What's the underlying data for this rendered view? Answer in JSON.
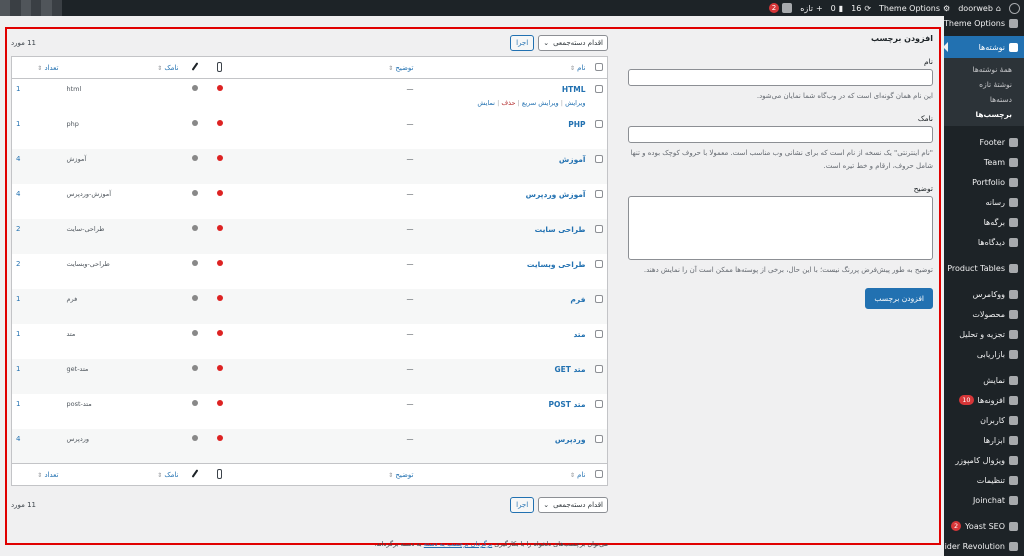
{
  "adminbar": {
    "site_name": "doorweb",
    "theme_options": "Theme Options",
    "updates_count": "16",
    "comments_count": "0",
    "new_label": "تازه",
    "yoast_badge": "2"
  },
  "sidebar": {
    "top_item": "Theme Options",
    "current": "نوشته‌ها",
    "submenu": [
      "همهٔ نوشته‌ها",
      "نوشتهٔ تازه",
      "دسته‌ها",
      "برچسب‌ها"
    ],
    "active_sub": "برچسب‌ها",
    "items": [
      {
        "label": "Footer",
        "icon": "copy-icon"
      },
      {
        "label": "Team",
        "icon": "team-icon"
      },
      {
        "label": "Portfolio",
        "icon": "portfolio-icon"
      },
      {
        "label": "رسانه",
        "icon": "media-icon"
      },
      {
        "label": "برگه‌ها",
        "icon": "pages-icon"
      },
      {
        "label": "دیدگاه‌ها",
        "icon": "comments-icon"
      },
      {
        "label": "Product Tables",
        "icon": "table-icon"
      },
      {
        "label": "ووکامرس",
        "icon": "woocommerce-icon"
      },
      {
        "label": "محصولات",
        "icon": "products-icon"
      },
      {
        "label": "تجزیه و تحلیل",
        "icon": "analytics-icon"
      },
      {
        "label": "بازاریابی",
        "icon": "megaphone-icon"
      },
      {
        "label": "نمایش",
        "icon": "appearance-icon"
      },
      {
        "label": "افزونه‌ها",
        "icon": "plugins-icon",
        "badge": "10"
      },
      {
        "label": "کاربران",
        "icon": "users-icon"
      },
      {
        "label": "ابزارها",
        "icon": "tools-icon"
      },
      {
        "label": "ویژوال کامپوزر",
        "icon": "composer-icon"
      },
      {
        "label": "تنظیمات",
        "icon": "settings-icon"
      },
      {
        "label": "Joinchat",
        "icon": "whatsapp-icon"
      },
      {
        "label": "Yoast SEO",
        "icon": "yoast-icon",
        "badge": "2"
      },
      {
        "label": "Slider Revolution",
        "icon": "refresh-icon"
      }
    ]
  },
  "form": {
    "title": "افزودن برچسب",
    "name_label": "نام",
    "name_help": "این نام همان گونه‌ای است که در وب‌گاه شما نمایان می‌شود.",
    "slug_label": "نامک",
    "slug_help": "\"نام اینترنتی\" یک نسخه از نام است که برای نشانی وب مناسب است. معمولا با حروف کوچک بوده و تنها شامل حروف، ارقام و خط تیره است.",
    "desc_label": "توضیح",
    "desc_help": "توضیح به طور پیش‌فرض پررنگ نیست؛ با این حال، برخی از پوسته‌ها ممکن است آن را نمایش دهند.",
    "submit": "افزودن برچسب"
  },
  "list": {
    "bulk_action": "اقدام دسته‌جمعی",
    "apply": "اجرا",
    "items_count": "11 مورد",
    "columns": {
      "name": "نام",
      "description": "توضیح",
      "slug": "نامک",
      "count": "تعداد"
    },
    "row_actions": [
      "ویرایش",
      "ویرایش سریع",
      "حذف",
      "نمایش"
    ],
    "rows": [
      {
        "name": "HTML",
        "description": "—",
        "slug": "html",
        "count": "1"
      },
      {
        "name": "PHP",
        "description": "—",
        "slug": "php",
        "count": "1"
      },
      {
        "name": "آموزش",
        "description": "—",
        "slug": "آموزش",
        "count": "4"
      },
      {
        "name": "آموزش وردپرس",
        "description": "—",
        "slug": "آموزش-وردپرس",
        "count": "4"
      },
      {
        "name": "طراحی سایت",
        "description": "—",
        "slug": "طراحی-سایت",
        "count": "2"
      },
      {
        "name": "طراحی وبسایت",
        "description": "—",
        "slug": "طراحی-وبسایت",
        "count": "2"
      },
      {
        "name": "فرم",
        "description": "—",
        "slug": "فرم",
        "count": "1"
      },
      {
        "name": "متد",
        "description": "—",
        "slug": "متد",
        "count": "1"
      },
      {
        "name": "متد GET",
        "description": "—",
        "slug": "متد-get",
        "count": "1"
      },
      {
        "name": "متد POST",
        "description": "—",
        "slug": "متد-post",
        "count": "1"
      },
      {
        "name": "وردپرس",
        "description": "—",
        "slug": "وردپرس",
        "count": "4"
      }
    ],
    "footer_note_pre": "می‌توان برچسب‌های دلخواه را با بکارگیری",
    "footer_note_link": "برگردان برچسب به دسته",
    "footer_note_post": "به دسته برگرداند."
  }
}
